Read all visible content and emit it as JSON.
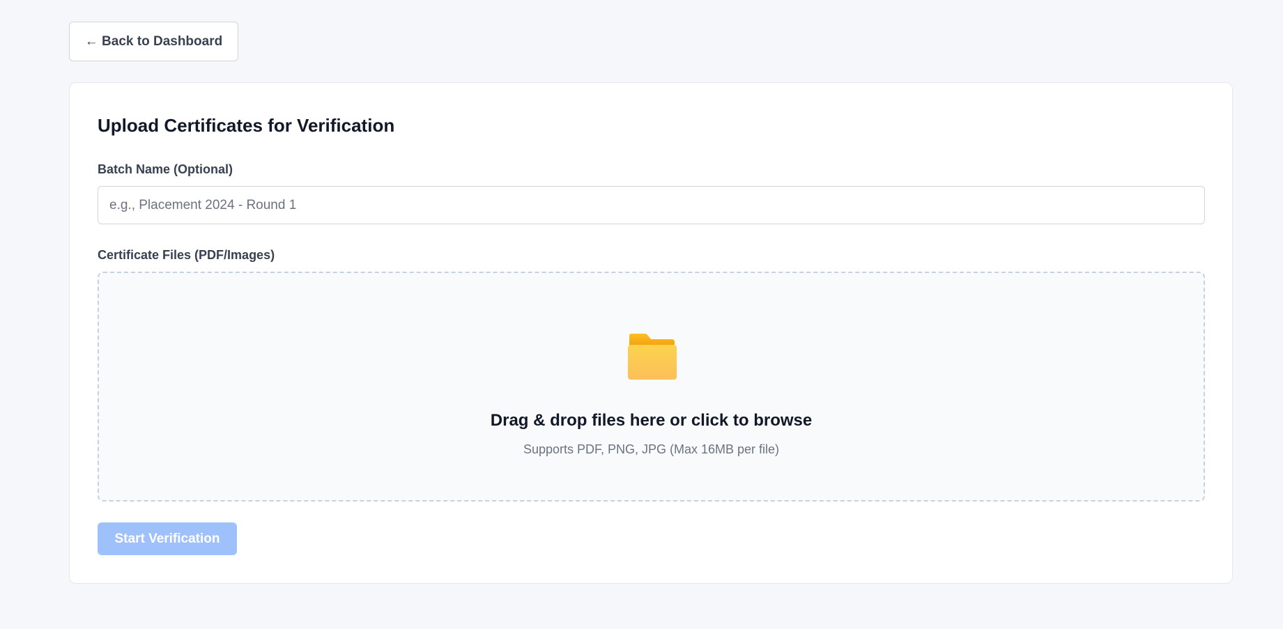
{
  "nav": {
    "back_label": "← Back to Dashboard"
  },
  "upload": {
    "title": "Upload Certificates for Verification",
    "batch_label": "Batch Name (Optional)",
    "batch_placeholder": "e.g., Placement 2024 - Round 1",
    "batch_value": "",
    "files_label": "Certificate Files (PDF/Images)",
    "dropzone": {
      "icon": "folder-icon",
      "title": "Drag & drop files here or click to browse",
      "subtitle": "Supports PDF, PNG, JPG (Max 16MB per file)"
    },
    "submit_label": "Start Verification",
    "submit_disabled": true
  },
  "colors": {
    "background": "#f5f7fa",
    "card": "#ffffff",
    "primary_disabled": "#9ec1fb",
    "folder": "#fbbf24"
  }
}
